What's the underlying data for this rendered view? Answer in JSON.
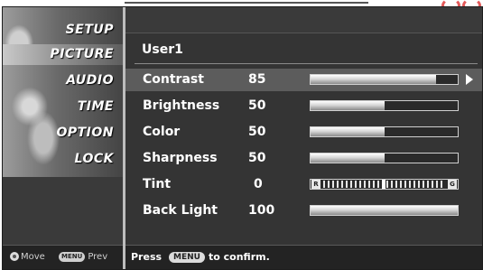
{
  "menu": {
    "items": [
      {
        "label": "SETUP",
        "active": false
      },
      {
        "label": "PICTURE",
        "active": true
      },
      {
        "label": "AUDIO",
        "active": false
      },
      {
        "label": "TIME",
        "active": false
      },
      {
        "label": "OPTION",
        "active": false
      },
      {
        "label": "LOCK",
        "active": false
      }
    ],
    "footer": {
      "move_icon": "move-icon",
      "move_label": "Move",
      "prev_key": "MENU",
      "prev_label": "Prev"
    }
  },
  "panel": {
    "title": "User1",
    "rows": [
      {
        "label": "Contrast",
        "value": "85",
        "level": 0.85,
        "selected": true
      },
      {
        "label": "Brightness",
        "value": "50",
        "level": 0.5,
        "selected": false
      },
      {
        "label": "Color",
        "value": "50",
        "level": 0.5,
        "selected": false
      },
      {
        "label": "Sharpness",
        "value": "50",
        "level": 0.5,
        "selected": false
      },
      {
        "label": "Tint",
        "value": "0",
        "tint_left": "R",
        "tint_right": "G",
        "selected": false
      },
      {
        "label": "Back Light",
        "value": "100",
        "level": 1.0,
        "selected": false
      }
    ],
    "footer": {
      "press": "Press",
      "key": "MENU",
      "confirm": "to confirm."
    }
  },
  "colors": {
    "background": "#343434",
    "selected_row": "#5c5c5c",
    "accent": "#e35a5a"
  }
}
